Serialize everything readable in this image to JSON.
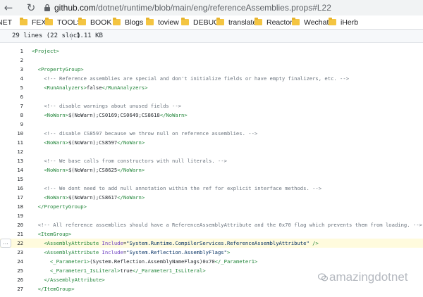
{
  "browser": {
    "url_domain": "github.com",
    "url_path": "/dotnet/runtime/blob/main/eng/referenceAssemblies.props#L22"
  },
  "bookmarks": [
    {
      "label": "NET",
      "folder": false
    },
    {
      "label": "FEX",
      "folder": true
    },
    {
      "label": "TOOLS",
      "folder": true
    },
    {
      "label": "BOOK",
      "folder": true
    },
    {
      "label": "Blogs",
      "folder": true
    },
    {
      "label": "toview",
      "folder": true
    },
    {
      "label": "DEBUG",
      "folder": true
    },
    {
      "label": "translate",
      "folder": true
    },
    {
      "label": "Reactor",
      "folder": true
    },
    {
      "label": "Wechat",
      "folder": true
    },
    {
      "label": "iHerb",
      "folder": true
    }
  ],
  "file_info": {
    "lines": "29 lines (22 sloc)",
    "size": "1.11 KB"
  },
  "highlighted_line": 22,
  "code_lines": [
    {
      "n": "1",
      "text": "<Project>"
    },
    {
      "n": "2",
      "text": ""
    },
    {
      "n": "3",
      "text": "  <PropertyGroup>"
    },
    {
      "n": "4",
      "text": "    <!-- Reference assemblies are special and don't initialize fields or have empty finalizers, etc. -->"
    },
    {
      "n": "5",
      "text": "    <RunAnalyzers>false</RunAnalyzers>"
    },
    {
      "n": "6",
      "text": ""
    },
    {
      "n": "7",
      "text": "    <!-- disable warnings about unused fields -->"
    },
    {
      "n": "8",
      "text": "    <NoWarn>$(NoWarn);CS0169;CS0649;CS8618</NoWarn>"
    },
    {
      "n": "9",
      "text": ""
    },
    {
      "n": "10",
      "text": "    <!-- disable CS8597 because we throw null on reference assemblies. -->"
    },
    {
      "n": "11",
      "text": "    <NoWarn>$(NoWarn);CS8597</NoWarn>"
    },
    {
      "n": "12",
      "text": ""
    },
    {
      "n": "13",
      "text": "    <!-- We base calls from constructors with null literals. -->"
    },
    {
      "n": "14",
      "text": "    <NoWarn>$(NoWarn);CS8625</NoWarn>"
    },
    {
      "n": "15",
      "text": ""
    },
    {
      "n": "16",
      "text": "    <!-- We dont need to add null annotation within the ref for explicit interface methods. -->"
    },
    {
      "n": "17",
      "text": "    <NoWarn>$(NoWarn);CS8617</NoWarn>"
    },
    {
      "n": "18",
      "text": "  </PropertyGroup>"
    },
    {
      "n": "19",
      "text": ""
    },
    {
      "n": "20",
      "text": "  <!-- All reference assemblies should have a ReferenceAssemblyAttribute and the 0x70 flag which prevents them from loading. -->"
    },
    {
      "n": "21",
      "text": "  <ItemGroup>"
    },
    {
      "n": "22",
      "text": "    <AssemblyAttribute Include=\"System.Runtime.CompilerServices.ReferenceAssemblyAttribute\" />"
    },
    {
      "n": "23",
      "text": "    <AssemblyAttribute Include=\"System.Reflection.AssemblyFlags\">"
    },
    {
      "n": "24",
      "text": "      <_Parameter1>(System.Reflection.AssemblyNameFlags)0x70</_Parameter1>"
    },
    {
      "n": "25",
      "text": "      <_Parameter1_IsLiteral>true</_Parameter1_IsLiteral>"
    },
    {
      "n": "26",
      "text": "    </AssemblyAttribute>"
    },
    {
      "n": "27",
      "text": "  </ItemGroup>"
    }
  ],
  "line_menu_label": "…",
  "watermark": "amazingdotnet"
}
